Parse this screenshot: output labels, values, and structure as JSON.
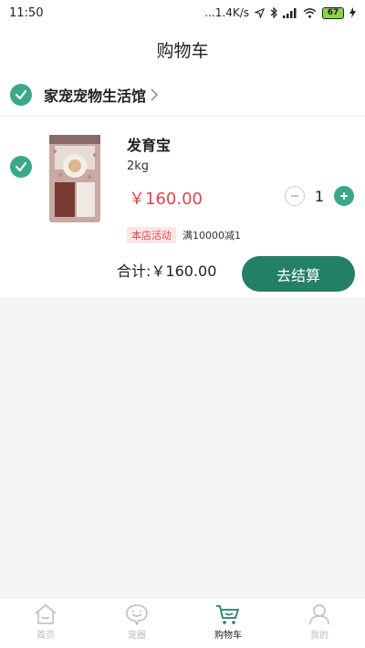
{
  "status": {
    "time": "11:50",
    "network": "...1.4K/s",
    "battery": "67"
  },
  "header": {
    "title": "购物车"
  },
  "store": {
    "name": "家宠宠物生活馆"
  },
  "item": {
    "name": "发育宝",
    "spec": "2kg",
    "price": "￥160.00",
    "quantity": "1",
    "promo_tag": "本店活动",
    "promo_text": "满10000减1"
  },
  "summary": {
    "total_label": "合计:",
    "total_value": "￥160.00",
    "checkout": "去结算"
  },
  "tabbar": {
    "tabs": [
      {
        "label": "首页",
        "icon": "home-icon"
      },
      {
        "label": "宠圈",
        "icon": "chat-bubble-icon"
      },
      {
        "label": "购物车",
        "icon": "cart-icon"
      },
      {
        "label": "我的",
        "icon": "profile-icon"
      }
    ],
    "active": "购物车"
  },
  "colors": {
    "accent": "#3aa887",
    "button": "#237f66",
    "price": "#e0454f"
  }
}
